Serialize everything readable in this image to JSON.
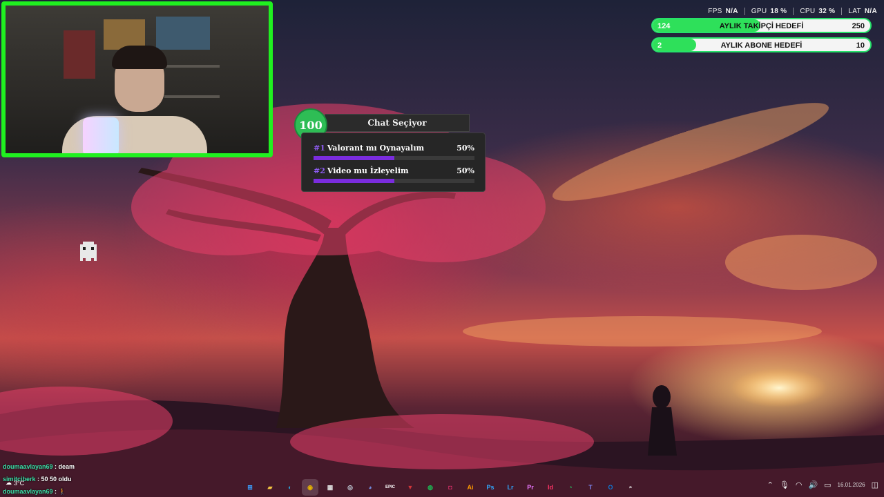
{
  "stats": [
    {
      "label": "FPS",
      "value": "N/A"
    },
    {
      "label": "GPU",
      "value": "18 %"
    },
    {
      "label": "CPU",
      "value": "32 %"
    },
    {
      "label": "LAT",
      "value": "N/A"
    }
  ],
  "goals": [
    {
      "current": "124",
      "label": "AYLIK TAKİPÇİ HEDEFİ",
      "target": "250",
      "progress": 0.496
    },
    {
      "current": "2",
      "label": "AYLIK ABONE HEDEFİ",
      "target": "10",
      "progress": 0.2
    }
  ],
  "poll": {
    "badge": "100",
    "title": "Chat Seçiyor",
    "options": [
      {
        "num": "#1",
        "label": "Valorant mı Oynayalım",
        "percent": "50%",
        "fraction": 0.5
      },
      {
        "num": "#2",
        "label": "Video mu İzleyelim",
        "percent": "50%",
        "fraction": 0.5
      }
    ]
  },
  "chat": [
    {
      "user": "doumaavlayan69",
      "message": " : deam"
    },
    {
      "user": "simitciberk",
      "message": " : 50 50 oldu"
    },
    {
      "user": "doumaavlayan69",
      "message": " : "
    }
  ],
  "weather": {
    "temp": "3°C"
  },
  "taskbar": {
    "apps": [
      {
        "name": "windows-start-icon",
        "glyph": "⊞",
        "color": "#3aa0ff"
      },
      {
        "name": "file-explorer-icon",
        "glyph": "▰",
        "color": "#f4c542"
      },
      {
        "name": "edge-icon",
        "glyph": "◐",
        "color": "#2aa8e0"
      },
      {
        "name": "chrome-icon",
        "glyph": "◉",
        "color": "#e6b400"
      },
      {
        "name": "store-icon",
        "glyph": "▦",
        "color": "#dddddd"
      },
      {
        "name": "steam-icon",
        "glyph": "◎",
        "color": "#c7d5e0"
      },
      {
        "name": "discord-icon",
        "glyph": "◕",
        "color": "#7289da"
      },
      {
        "name": "epic-games-icon",
        "glyph": "EPIC",
        "color": "#ffffff"
      },
      {
        "name": "riot-icon",
        "glyph": "▼",
        "color": "#d13639"
      },
      {
        "name": "spotify-icon",
        "glyph": "◍",
        "color": "#1db954"
      },
      {
        "name": "instagram-icon",
        "glyph": "◘",
        "color": "#e1306c"
      },
      {
        "name": "illustrator-icon",
        "glyph": "Ai",
        "color": "#ff9a00"
      },
      {
        "name": "photoshop-icon",
        "glyph": "Ps",
        "color": "#31a8ff"
      },
      {
        "name": "lightroom-icon",
        "glyph": "Lr",
        "color": "#31a8ff"
      },
      {
        "name": "premiere-icon",
        "glyph": "Pr",
        "color": "#ea77ff"
      },
      {
        "name": "indesign-icon",
        "glyph": "Id",
        "color": "#ff3366"
      },
      {
        "name": "whatsapp-icon",
        "glyph": "◔",
        "color": "#25d366"
      },
      {
        "name": "teams-icon",
        "glyph": "T",
        "color": "#7b83eb"
      },
      {
        "name": "outlook-icon",
        "glyph": "O",
        "color": "#0f78d4"
      },
      {
        "name": "obs-icon",
        "glyph": "◓",
        "color": "#e8e8e8"
      }
    ],
    "active_index": 3,
    "date": "16.01.2026"
  }
}
